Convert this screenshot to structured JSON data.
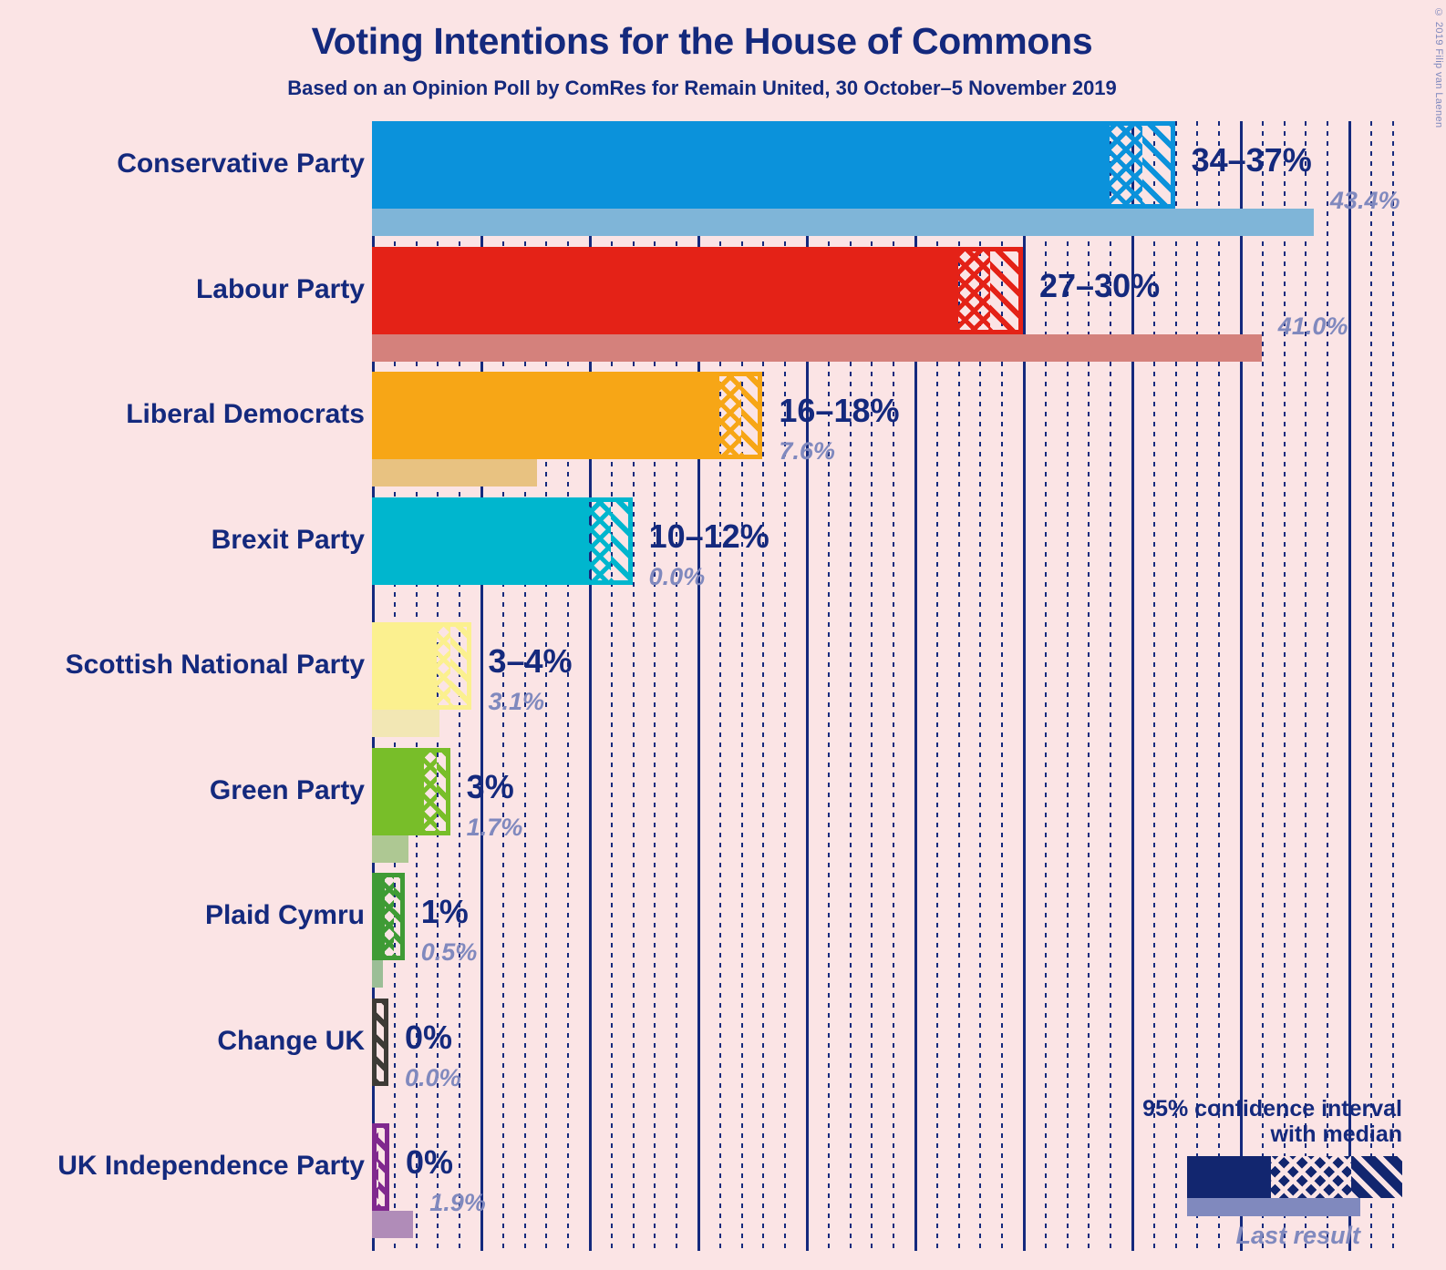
{
  "header": {
    "title": "Voting Intentions for the House of Commons",
    "subtitle": "Based on an Opinion Poll by ComRes for Remain United, 30 October–5 November 2019",
    "copyright": "© 2019 Filip van Laenen"
  },
  "legend": {
    "line1": "95% confidence interval",
    "line2": "with median",
    "last_result_label": "Last result"
  },
  "colors": {
    "background": "#FBE4E5",
    "text_navy": "#14297D",
    "muted": "#8089BE",
    "legend_bar": "#12266F"
  },
  "chart_data": {
    "type": "bar",
    "title": "Voting Intentions for the House of Commons",
    "subtitle": "Based on an Opinion Poll by ComRes for Remain United, 30 October–5 November 2019",
    "xlabel": "",
    "ylabel": "",
    "xlim": [
      0,
      47.5
    ],
    "grid": true,
    "grid_major_step": 5,
    "grid_minor_step": 1,
    "legend_position": "bottom-right",
    "value_unit": "%",
    "categories": [
      "Conservative Party",
      "Labour Party",
      "Liberal Democrats",
      "Brexit Party",
      "Scottish National Party",
      "Green Party",
      "Plaid Cymru",
      "Change UK",
      "UK Independence Party"
    ],
    "series": [
      {
        "name": "95% confidence interval with median",
        "values": [
          35.5,
          28.5,
          17.0,
          11.0,
          3.5,
          3.0,
          1.0,
          0.2,
          0.4
        ]
      },
      {
        "name": "Last result",
        "values": [
          43.4,
          41.0,
          7.6,
          0.0,
          3.1,
          1.7,
          0.5,
          0.0,
          1.9
        ]
      }
    ],
    "bars": [
      {
        "party": "Conservative Party",
        "range_label": "34–37%",
        "ci_low": 34.0,
        "ci_high": 37.0,
        "median": 35.5,
        "last_result": 43.4,
        "last_result_label": "43.4%",
        "color": "#0B92DB",
        "last_color": "#7FB5D8"
      },
      {
        "party": "Labour Party",
        "range_label": "27–30%",
        "ci_low": 27.0,
        "ci_high": 30.0,
        "median": 28.5,
        "last_result": 41.0,
        "last_result_label": "41.0%",
        "color": "#E42217",
        "last_color": "#D4817C"
      },
      {
        "party": "Liberal Democrats",
        "range_label": "16–18%",
        "ci_low": 16.0,
        "ci_high": 18.0,
        "median": 17.0,
        "last_result": 7.6,
        "last_result_label": "7.6%",
        "color": "#F7A616",
        "last_color": "#E8C281"
      },
      {
        "party": "Brexit Party",
        "range_label": "10–12%",
        "ci_low": 10.0,
        "ci_high": 12.0,
        "median": 11.0,
        "last_result": 0.0,
        "last_result_label": "0.0%",
        "color": "#00B6CE",
        "last_color": "#88C9D4"
      },
      {
        "party": "Scottish National Party",
        "range_label": "3–4%",
        "ci_low": 3.0,
        "ci_high": 4.6,
        "median": 3.6,
        "last_result": 3.1,
        "last_result_label": "3.1%",
        "color": "#FBF08F",
        "last_color": "#F2E7B4"
      },
      {
        "party": "Green Party",
        "range_label": "3%",
        "ci_low": 2.4,
        "ci_high": 3.6,
        "median": 3.0,
        "last_result": 1.7,
        "last_result_label": "1.7%",
        "color": "#78BE29",
        "last_color": "#AEC893"
      },
      {
        "party": "Plaid Cymru",
        "range_label": "1%",
        "ci_low": 0.6,
        "ci_high": 1.5,
        "median": 1.0,
        "last_result": 0.5,
        "last_result_label": "0.5%",
        "color": "#3F9B35",
        "last_color": "#9BBE96"
      },
      {
        "party": "Change UK",
        "range_label": "0%",
        "ci_low": 0.0,
        "ci_high": 0.7,
        "median": 0.2,
        "last_result": 0.0,
        "last_result_label": "0.0%",
        "color": "#3D3B36",
        "last_color": "#9C9B97"
      },
      {
        "party": "UK Independence Party",
        "range_label": "0%",
        "ci_low": 0.0,
        "ci_high": 0.8,
        "median": 0.3,
        "last_result": 1.9,
        "last_result_label": "1.9%",
        "color": "#80288E",
        "last_color": "#B08CB8"
      }
    ]
  }
}
